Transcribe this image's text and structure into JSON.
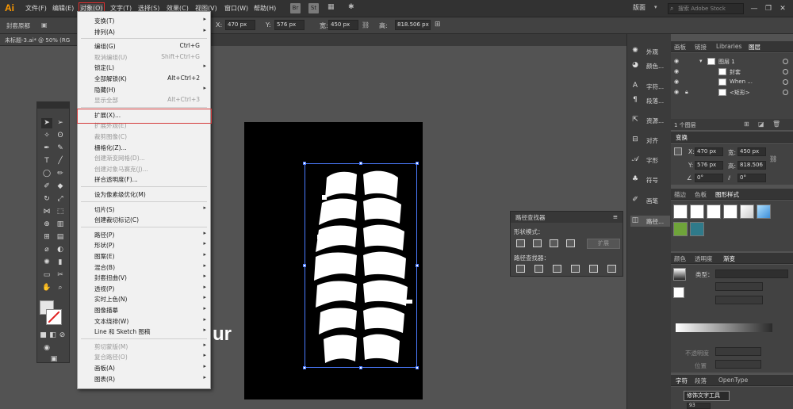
{
  "app": {
    "logo": "Ai"
  },
  "menubar": {
    "items": [
      "文件(F)",
      "编辑(E)",
      "对象(O)",
      "文字(T)",
      "选择(S)",
      "效果(C)",
      "视图(V)",
      "窗口(W)",
      "帮助(H)"
    ],
    "badges": [
      "Br",
      "St"
    ],
    "workspace": "版面",
    "stock_search_placeholder": "搜索 Adobe Stock",
    "window_controls": [
      "—",
      "❐",
      "✕"
    ]
  },
  "control_bar": {
    "selection_label": "封套原都",
    "x_label": "X:",
    "x_value": "470 px",
    "y_label": "Y:",
    "y_value": "576 px",
    "w_label": "宽:",
    "w_value": "450 px",
    "h_label": "高:",
    "h_value": "818.506 px"
  },
  "document": {
    "tab_label": "未标题-3.ai* @ 50% (RG"
  },
  "object_menu": {
    "items": [
      {
        "label": "变换(T)",
        "arrow": true
      },
      {
        "label": "排列(A)",
        "arrow": true
      },
      {
        "sep": true
      },
      {
        "label": "编组(G)",
        "shortcut": "Ctrl+G"
      },
      {
        "label": "取消编组(U)",
        "shortcut": "Shift+Ctrl+G",
        "disabled": true
      },
      {
        "label": "锁定(L)",
        "arrow": true
      },
      {
        "label": "全部解锁(K)",
        "shortcut": "Alt+Ctrl+2"
      },
      {
        "label": "隐藏(H)",
        "arrow": true
      },
      {
        "label": "显示全部",
        "shortcut": "Alt+Ctrl+3",
        "disabled": true
      },
      {
        "sep": true
      },
      {
        "label": "扩展(X)..."
      },
      {
        "label": "扩展外观(E)",
        "disabled": true
      },
      {
        "label": "裁剪图像(C)",
        "disabled": true
      },
      {
        "label": "栅格化(Z)..."
      },
      {
        "label": "创建渐变网格(D)...",
        "disabled": true
      },
      {
        "label": "创建对象马赛克(J)...",
        "disabled": true
      },
      {
        "label": "拼合透明度(F)..."
      },
      {
        "sep": true
      },
      {
        "label": "设为像素级优化(M)"
      },
      {
        "sep": true
      },
      {
        "label": "切片(S)",
        "arrow": true
      },
      {
        "label": "创建裁切标记(C)"
      },
      {
        "sep": true
      },
      {
        "label": "路径(P)",
        "arrow": true
      },
      {
        "label": "形状(P)",
        "arrow": true
      },
      {
        "label": "图案(E)",
        "arrow": true
      },
      {
        "label": "混合(B)",
        "arrow": true
      },
      {
        "label": "封套扭曲(V)",
        "arrow": true
      },
      {
        "label": "透视(P)",
        "arrow": true
      },
      {
        "label": "实时上色(N)",
        "arrow": true
      },
      {
        "label": "图像描摹",
        "arrow": true
      },
      {
        "label": "文本绕排(W)",
        "arrow": true
      },
      {
        "label": "Line 和 Sketch 图稿",
        "arrow": true
      },
      {
        "sep": true
      },
      {
        "label": "剪切蒙版(M)",
        "arrow": true,
        "disabled": true
      },
      {
        "label": "复合路径(O)",
        "arrow": true,
        "disabled": true
      },
      {
        "label": "画板(A)",
        "arrow": true
      },
      {
        "label": "图表(R)",
        "arrow": true
      }
    ]
  },
  "canvas": {
    "partial_text": "ur"
  },
  "pathfinder": {
    "title": "路径查找器",
    "shape_modes_label": "形状模式：",
    "expand_label": "扩展",
    "pathfinders_label": "路径查找器："
  },
  "dock": {
    "items": [
      "外观",
      "颜色...",
      "字符...",
      "段落...",
      "资源...",
      "对齐",
      "字形",
      "符号",
      "画笔",
      "路径..."
    ]
  },
  "layers_panel": {
    "tabs": [
      "画板",
      "链接",
      "Libraries",
      "图层"
    ],
    "rows": [
      {
        "name": "图层 1"
      },
      {
        "name": "封套"
      },
      {
        "name": "When ..."
      },
      {
        "name": "<矩形>"
      }
    ],
    "footer": "1 个图层"
  },
  "transform_panel": {
    "title": "变换",
    "x_label": "X:",
    "x_value": "470 px",
    "w_label": "宽:",
    "w_value": "450 px",
    "y_label": "Y:",
    "y_value": "576 px",
    "h_label": "高:",
    "h_value": "818.506",
    "angle_value": "0°",
    "shear_value": "0°"
  },
  "styles_panel": {
    "tabs": [
      "描边",
      "色板",
      "图形样式"
    ]
  },
  "gradient_panel": {
    "tabs": [
      "颜色",
      "透明度",
      "渐变"
    ],
    "type_label": "类型：",
    "opacity_label": "不透明度",
    "position_label": "位置"
  },
  "char_panel": {
    "tabs": [
      "字符",
      "段落",
      "OpenType"
    ],
    "tooltip": "修饰文字工具",
    "field_value": "93"
  }
}
